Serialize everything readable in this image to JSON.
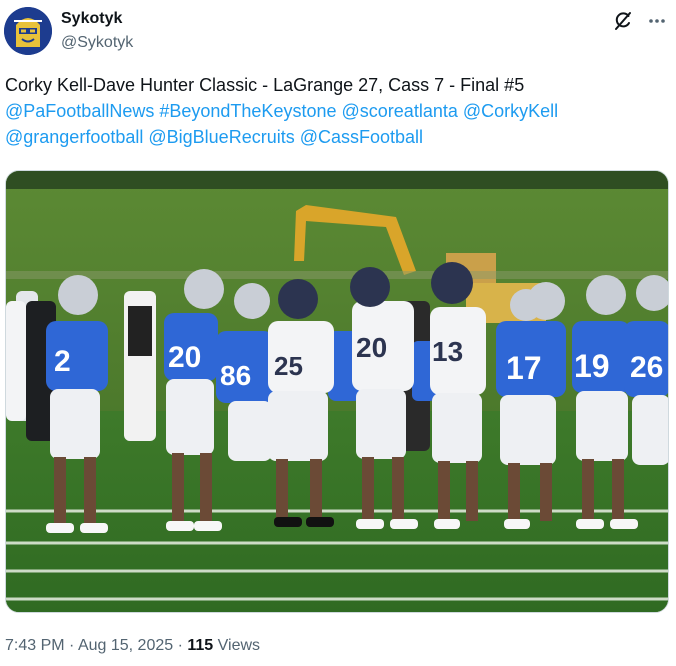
{
  "author": {
    "display_name": "Sykotyk",
    "handle": "@Sykotyk"
  },
  "header_icons": [
    "grok-icon",
    "more-icon"
  ],
  "tweet": {
    "text_intro": "Corky Kell-Dave Hunter Classic - LaGrange 27, Cass 7 - Final #5",
    "mentions": [
      "@PaFootballNews",
      "#BeyondTheKeystone",
      "@scoreatlanta",
      "@CorkyKell",
      "@grangerfootball",
      "@BigBlueRecruits",
      "@CassFootball"
    ]
  },
  "meta": {
    "time": "7:43 PM",
    "separator": "·",
    "date": "Aug 15, 2025",
    "views_count": "115",
    "views_label": "Views"
  },
  "colors": {
    "link": "#1d9bf0",
    "muted": "#536471",
    "text": "#0f1419"
  }
}
